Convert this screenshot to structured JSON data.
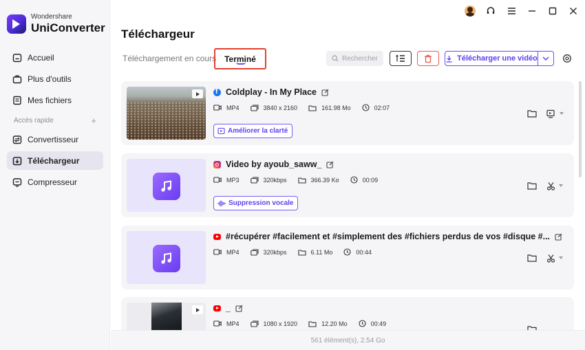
{
  "app": {
    "brand": "Wondershare",
    "product": "UniConverter"
  },
  "sidebar": {
    "items_top": [
      {
        "label": "Accueil",
        "icon": "home-icon"
      },
      {
        "label": "Plus d'outils",
        "icon": "toolbox-icon"
      },
      {
        "label": "Mes fichiers",
        "icon": "files-icon"
      }
    ],
    "section_label": "Accès rapide",
    "section_add": "+",
    "items_quick": [
      {
        "label": "Convertisseur",
        "icon": "convert-icon"
      },
      {
        "label": "Téléchargeur",
        "icon": "download-icon",
        "active": true
      },
      {
        "label": "Compresseur",
        "icon": "compress-icon"
      }
    ]
  },
  "header": {
    "title": "Téléchargeur",
    "tabs": [
      {
        "label": "Téléchargement en cours"
      },
      {
        "label": "Terminé",
        "active": true
      }
    ],
    "search_placeholder": "Rechercher",
    "download_button": "Télécharger une vidéo"
  },
  "items": [
    {
      "source": "facebook",
      "title": "Coldplay - In My Place",
      "format": "MP4",
      "resolution": "3840 x 2160",
      "size": "161.98 Mo",
      "duration": "02:07",
      "enhance_label": "Améliorer la clarté",
      "action_icon": "screen-icon"
    },
    {
      "source": "instagram",
      "title": "Video by ayoub_saww_",
      "format": "MP3",
      "resolution": "320kbps",
      "size": "366.39 Ko",
      "duration": "00:09",
      "enhance_label": "Suppression vocale",
      "action_icon": "scissors-icon"
    },
    {
      "source": "youtube",
      "title": "#récupérer #facilement et #simplement des #fichiers perdus de vos #disque #...",
      "format": "MP4",
      "resolution": "320kbps",
      "size": "6.11 Mo",
      "duration": "00:44",
      "action_icon": "scissors-icon"
    },
    {
      "source": "youtube",
      "title": "_",
      "format": "MP4",
      "resolution": "1080 x 1920",
      "size": "12.20 Mo",
      "duration": "00:49"
    }
  ],
  "footer": {
    "summary": "561 élément(s), 2.54 Go"
  },
  "colors": {
    "accent": "#6a4cf3",
    "highlight_border": "#e1402d",
    "delete": "#e85a4f"
  }
}
